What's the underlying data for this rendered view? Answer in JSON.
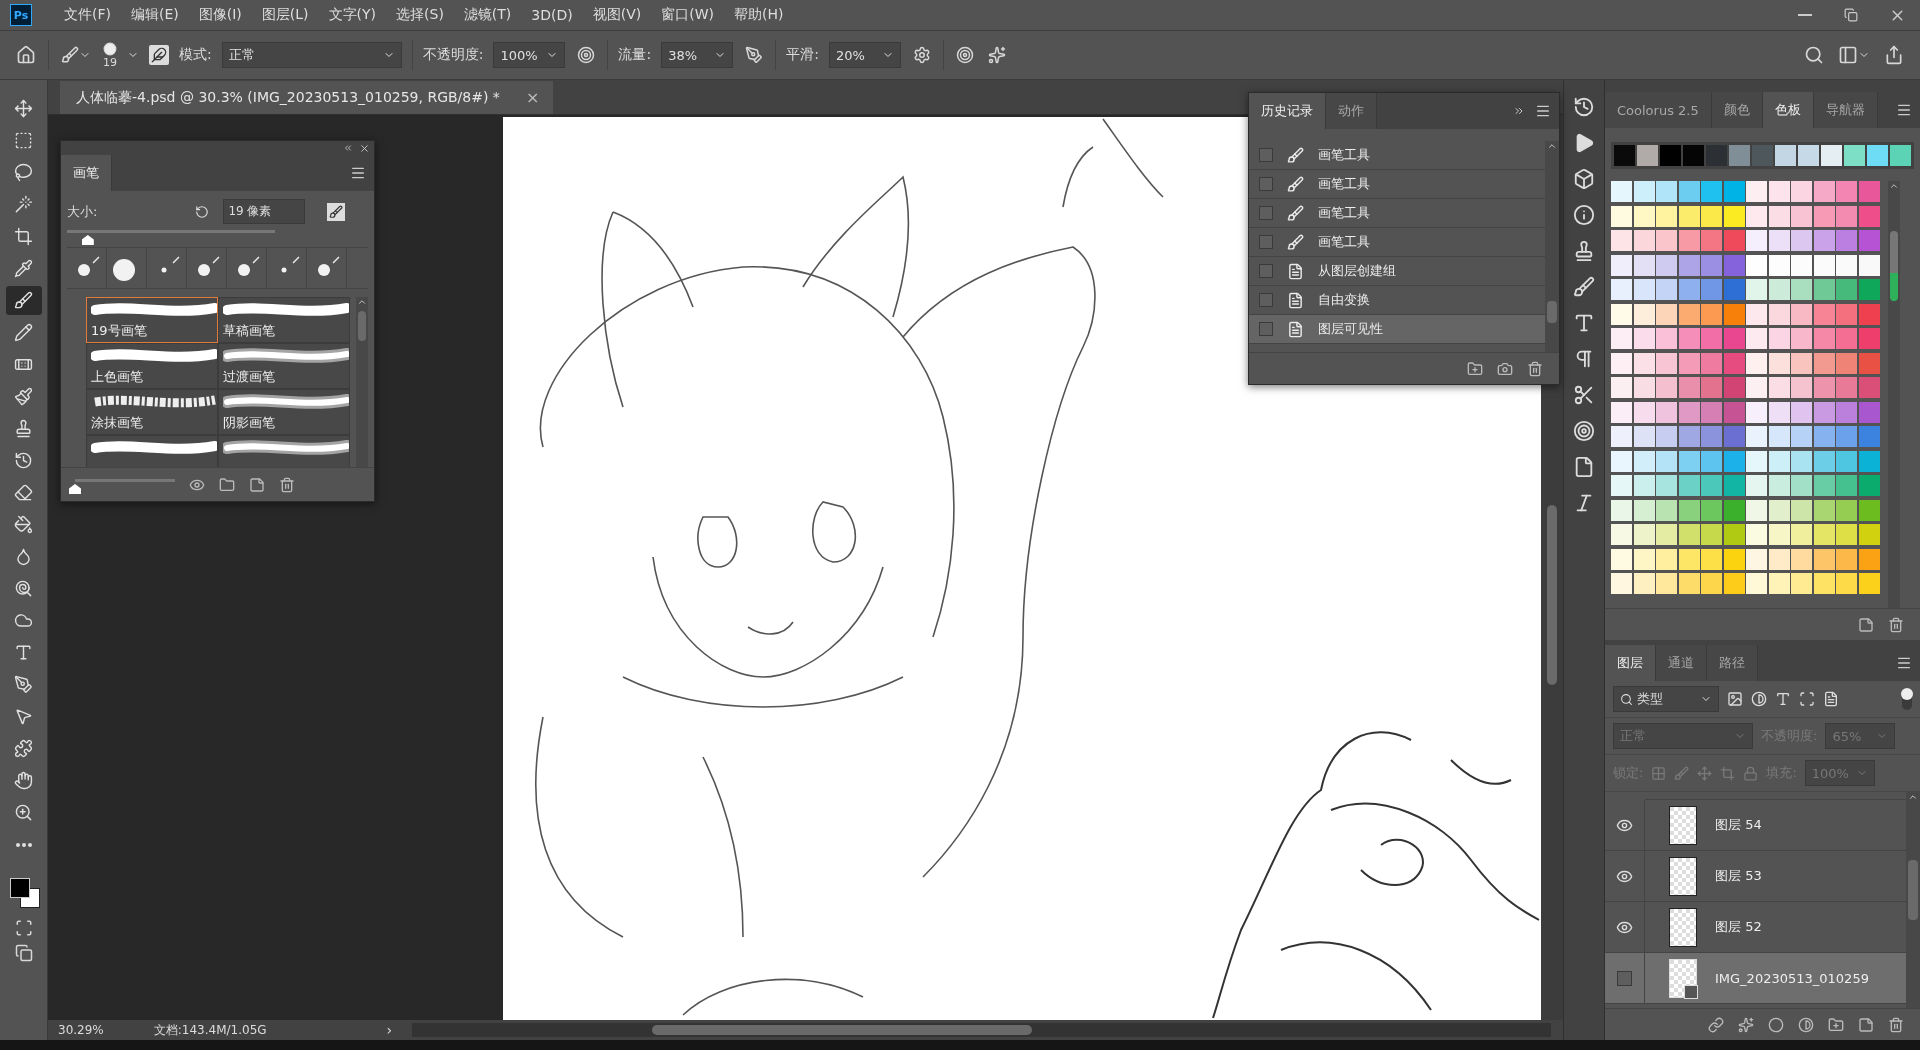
{
  "menu": {
    "logo": "Ps",
    "items": [
      "文件(F)",
      "编辑(E)",
      "图像(I)",
      "图层(L)",
      "文字(Y)",
      "选择(S)",
      "滤镜(T)",
      "3D(D)",
      "视图(V)",
      "窗口(W)",
      "帮助(H)"
    ]
  },
  "options_bar": {
    "brush_size": "19",
    "mode_label": "模式:",
    "mode": "正常",
    "opacity_label": "不透明度:",
    "opacity": "100%",
    "flow_label": "流量:",
    "flow": "38%",
    "smoothing_label": "平滑:",
    "smoothing": "20%"
  },
  "tools": [
    {
      "kind": "move",
      "selected": false
    },
    {
      "kind": "marquee",
      "selected": false
    },
    {
      "kind": "lasso",
      "selected": false
    },
    {
      "kind": "wand",
      "selected": false
    },
    {
      "kind": "crop",
      "selected": false
    },
    {
      "kind": "eyedropper",
      "selected": false
    },
    {
      "kind": "brush",
      "selected": true
    },
    {
      "kind": "pencil",
      "selected": false
    },
    {
      "kind": "healing",
      "selected": false
    },
    {
      "kind": "mixer",
      "selected": false
    },
    {
      "kind": "stamp",
      "selected": false
    },
    {
      "kind": "history",
      "selected": false
    },
    {
      "kind": "eraser",
      "selected": false
    },
    {
      "kind": "bucket",
      "selected": false
    },
    {
      "kind": "blur",
      "selected": false
    },
    {
      "kind": "dodge",
      "selected": false
    },
    {
      "kind": "sponge",
      "selected": false
    },
    {
      "kind": "type",
      "selected": false
    },
    {
      "kind": "pen",
      "selected": false
    },
    {
      "kind": "path",
      "selected": false
    },
    {
      "kind": "shape",
      "selected": false
    },
    {
      "kind": "hand",
      "selected": false
    },
    {
      "kind": "zoom",
      "selected": false
    },
    {
      "kind": "more",
      "selected": false
    }
  ],
  "document_tab": {
    "title": "人体临摹-4.psd @ 30.3% (IMG_20230513_010259, RGB/8#) *",
    "close": "×"
  },
  "brush_panel": {
    "tab": "画笔",
    "size_label": "大小:",
    "size_value": "19 像素",
    "size_slider": {
      "level": 0.1
    },
    "scale_slider": {
      "level": 0
    },
    "presets": [
      {
        "name": "19号画笔",
        "kind": "smooth",
        "selected": true
      },
      {
        "name": "草稿画笔",
        "kind": "smooth",
        "selected": false
      },
      {
        "name": "上色画笔",
        "kind": "smooth",
        "selected": false
      },
      {
        "name": "过渡画笔",
        "kind": "soft",
        "selected": false
      },
      {
        "name": "涂抹画笔",
        "kind": "textured",
        "selected": false
      },
      {
        "name": "阴影画笔",
        "kind": "soft",
        "selected": false
      },
      {
        "kind": "smooth",
        "selected": false
      },
      {
        "kind": "soft",
        "selected": false
      }
    ]
  },
  "history": {
    "tabs": [
      {
        "label": "历史记录",
        "selected": true
      },
      {
        "label": "动作",
        "selected": false
      }
    ],
    "items": [
      {
        "kind": "brush",
        "label": "画笔工具",
        "checked": false,
        "selected": false
      },
      {
        "kind": "brush",
        "label": "画笔工具",
        "checked": false,
        "selected": false
      },
      {
        "kind": "brush",
        "label": "画笔工具",
        "checked": false,
        "selected": false
      },
      {
        "kind": "brush",
        "label": "画笔工具",
        "checked": false,
        "selected": false
      },
      {
        "kind": "document",
        "label": "从图层创建组",
        "checked": false,
        "selected": false
      },
      {
        "kind": "document",
        "label": "自由变换",
        "checked": false,
        "selected": false
      },
      {
        "kind": "document",
        "label": "图层可见性",
        "checked": false,
        "selected": true
      }
    ]
  },
  "swatches": {
    "tabs": [
      {
        "label": "Coolorus 2.5",
        "selected": false
      },
      {
        "label": "颜色",
        "selected": false
      },
      {
        "label": "色板",
        "selected": true
      },
      {
        "label": "导航器",
        "selected": false
      }
    ],
    "recent": [
      {
        "color": "#0a0a0a"
      },
      {
        "color": "#b0aba8"
      },
      {
        "color": "#000000"
      },
      {
        "color": "#050505"
      },
      {
        "color": "#2c3034"
      },
      {
        "color": "#7f8e97"
      },
      {
        "color": "#4d575c"
      },
      {
        "color": "#c2d7e3"
      },
      {
        "color": "#c6d9e6"
      },
      {
        "color": "#e4eef3"
      },
      {
        "color": "#7ddfc6"
      },
      {
        "color": "#6fdcf5"
      },
      {
        "color": "#5dd3b5"
      }
    ],
    "rows": [
      [
        {
          "color": "#e6f6fd"
        },
        {
          "color": "#cdeefb"
        },
        {
          "color": "#b0e4f8"
        },
        {
          "color": "#6dcdf0"
        },
        {
          "color": "#1fc1ee"
        },
        {
          "color": "#00b3e6"
        },
        {
          "color": "#fdeef2"
        },
        {
          "color": "#fde4ec"
        },
        {
          "color": "#fbd5e2"
        },
        {
          "color": "#f6a9c7"
        },
        {
          "color": "#f285b2"
        },
        {
          "color": "#e7579a"
        }
      ],
      [
        {
          "color": "#fffbe0"
        },
        {
          "color": "#fff8c4"
        },
        {
          "color": "#fff3a0"
        },
        {
          "color": "#fcec6c"
        },
        {
          "color": "#fbe94a"
        },
        {
          "color": "#fbeb23"
        },
        {
          "color": "#fde9ee"
        },
        {
          "color": "#fbdde6"
        },
        {
          "color": "#f8c3d2"
        },
        {
          "color": "#f69ab6"
        },
        {
          "color": "#f38ab0"
        },
        {
          "color": "#ee4f8b"
        }
      ],
      [
        {
          "color": "#fde5e7"
        },
        {
          "color": "#fbd6da"
        },
        {
          "color": "#fac6cc"
        },
        {
          "color": "#f79aa5"
        },
        {
          "color": "#f47684"
        },
        {
          "color": "#ef4a5c"
        },
        {
          "color": "#f5eefc"
        },
        {
          "color": "#ecdff8"
        },
        {
          "color": "#dcc7f1"
        },
        {
          "color": "#c9a2e9"
        },
        {
          "color": "#bb7fe1"
        },
        {
          "color": "#b553d4"
        }
      ],
      [
        {
          "color": "#efeefa"
        },
        {
          "color": "#e3e0f6"
        },
        {
          "color": "#cfcaf0"
        },
        {
          "color": "#ada4e8"
        },
        {
          "color": "#9b8fe3"
        },
        {
          "color": "#8463dc"
        },
        {
          "color": "#fefefe"
        },
        {
          "color": "#fdfdfd"
        },
        {
          "color": "#fcfcfc"
        },
        {
          "color": "#fbfbfb"
        },
        {
          "color": "#fafafa"
        },
        {
          "color": "#f9f9f9"
        }
      ],
      [
        {
          "color": "#e8f0fd"
        },
        {
          "color": "#d8e5fb"
        },
        {
          "color": "#c3d4f7"
        },
        {
          "color": "#8fb0ee"
        },
        {
          "color": "#6f97e6"
        },
        {
          "color": "#2e6fd6"
        },
        {
          "color": "#e2f5ea"
        },
        {
          "color": "#ccecd9"
        },
        {
          "color": "#a9dfbf"
        },
        {
          "color": "#6ec997"
        },
        {
          "color": "#45ba7b"
        },
        {
          "color": "#0fa85a"
        }
      ],
      [
        {
          "color": "#fffbe8"
        },
        {
          "color": "#fdeedc"
        },
        {
          "color": "#fcd5b8"
        },
        {
          "color": "#fcab70"
        },
        {
          "color": "#fb9a50"
        },
        {
          "color": "#f7800a"
        },
        {
          "color": "#fde9ed"
        },
        {
          "color": "#fbd7de"
        },
        {
          "color": "#f9b9c4"
        },
        {
          "color": "#f68494"
        },
        {
          "color": "#f4707f"
        },
        {
          "color": "#ef4050"
        }
      ],
      [
        {
          "color": "#fdeef5"
        },
        {
          "color": "#fbdcea"
        },
        {
          "color": "#f9c0d8"
        },
        {
          "color": "#f58fba"
        },
        {
          "color": "#f26ea6"
        },
        {
          "color": "#e94790"
        },
        {
          "color": "#fde9f0"
        },
        {
          "color": "#fbd5e3"
        },
        {
          "color": "#f8b7ca"
        },
        {
          "color": "#f588a6"
        },
        {
          "color": "#f36e92"
        },
        {
          "color": "#ee3e6c"
        }
      ],
      [
        {
          "color": "#fdeff3"
        },
        {
          "color": "#fbe0e8"
        },
        {
          "color": "#f8c5d4"
        },
        {
          "color": "#f49cb7"
        },
        {
          "color": "#f07ba0"
        },
        {
          "color": "#e74c81"
        },
        {
          "color": "#fdf0ee"
        },
        {
          "color": "#fbe0dc"
        },
        {
          "color": "#f8c4bd"
        },
        {
          "color": "#f29a8f"
        },
        {
          "color": "#ef8375"
        },
        {
          "color": "#e95145"
        }
      ],
      [
        {
          "color": "#fceff2"
        },
        {
          "color": "#f9dde4"
        },
        {
          "color": "#f4bfce"
        },
        {
          "color": "#ea8fab"
        },
        {
          "color": "#e3728f"
        },
        {
          "color": "#d24473"
        },
        {
          "color": "#fdf0f3"
        },
        {
          "color": "#fadde5"
        },
        {
          "color": "#f5c2d0"
        },
        {
          "color": "#ed93ac"
        },
        {
          "color": "#e87a98"
        },
        {
          "color": "#d94f77"
        }
      ],
      [
        {
          "color": "#fbeef6"
        },
        {
          "color": "#f6dcec"
        },
        {
          "color": "#efc2dd"
        },
        {
          "color": "#e099c4"
        },
        {
          "color": "#d67fb4"
        },
        {
          "color": "#c65394"
        },
        {
          "color": "#f7effb"
        },
        {
          "color": "#eedef6"
        },
        {
          "color": "#e0c3ef"
        },
        {
          "color": "#c999e2"
        },
        {
          "color": "#bb7fdc"
        },
        {
          "color": "#a957cf"
        }
      ],
      [
        {
          "color": "#eef0fb"
        },
        {
          "color": "#dee2f6"
        },
        {
          "color": "#c6cdf0"
        },
        {
          "color": "#a0a8e3"
        },
        {
          "color": "#8a93dc"
        },
        {
          "color": "#6a6fd1"
        },
        {
          "color": "#eaf2fd"
        },
        {
          "color": "#d6e6fb"
        },
        {
          "color": "#b7d2f7"
        },
        {
          "color": "#86b3ef"
        },
        {
          "color": "#6aa1ea"
        },
        {
          "color": "#3b83df"
        }
      ],
      [
        {
          "color": "#eaf6fd"
        },
        {
          "color": "#d3eefb"
        },
        {
          "color": "#b4e3f8"
        },
        {
          "color": "#7dd0f2"
        },
        {
          "color": "#5cc4ee"
        },
        {
          "color": "#1cb1e8"
        },
        {
          "color": "#e6f7fb"
        },
        {
          "color": "#cdeff7"
        },
        {
          "color": "#a9e3f1"
        },
        {
          "color": "#6dcfe7"
        },
        {
          "color": "#4ec5e1"
        },
        {
          "color": "#0cb1d6"
        }
      ],
      [
        {
          "color": "#e5f7f6"
        },
        {
          "color": "#cbefec"
        },
        {
          "color": "#a7e4df"
        },
        {
          "color": "#6bd1c7"
        },
        {
          "color": "#4cc8bb"
        },
        {
          "color": "#12b4a3"
        },
        {
          "color": "#e4f6ef"
        },
        {
          "color": "#c9eddf"
        },
        {
          "color": "#a3e0c8"
        },
        {
          "color": "#68cda4"
        },
        {
          "color": "#45c190"
        },
        {
          "color": "#0bab6e"
        }
      ],
      [
        {
          "color": "#eaf6e8"
        },
        {
          "color": "#d6eed2"
        },
        {
          "color": "#b9e3b1"
        },
        {
          "color": "#89d17d"
        },
        {
          "color": "#6cc75f"
        },
        {
          "color": "#3bb02c"
        },
        {
          "color": "#f0f7e6"
        },
        {
          "color": "#e2efcd"
        },
        {
          "color": "#cde5a8"
        },
        {
          "color": "#a9d670"
        },
        {
          "color": "#94cd52"
        },
        {
          "color": "#6cbb1f"
        }
      ],
      [
        {
          "color": "#f7f9e4"
        },
        {
          "color": "#eff3c9"
        },
        {
          "color": "#e4eca3"
        },
        {
          "color": "#d1e06a"
        },
        {
          "color": "#c6d94b"
        },
        {
          "color": "#b0ca14"
        },
        {
          "color": "#fbfbe2"
        },
        {
          "color": "#f6f6c6"
        },
        {
          "color": "#efef9e"
        },
        {
          "color": "#e4e465"
        },
        {
          "color": "#dede46"
        },
        {
          "color": "#d1d10f"
        }
      ],
      [
        {
          "color": "#fffbe2"
        },
        {
          "color": "#fff6c6"
        },
        {
          "color": "#ffef9e"
        },
        {
          "color": "#fde566"
        },
        {
          "color": "#fde047"
        },
        {
          "color": "#fbd30f"
        },
        {
          "color": "#fff5e3"
        },
        {
          "color": "#ffebc8"
        },
        {
          "color": "#ffdba0"
        },
        {
          "color": "#fdc468"
        },
        {
          "color": "#fdb84a"
        },
        {
          "color": "#fba114"
        }
      ],
      [
        {
          "color": "#fff7e0"
        },
        {
          "color": "#fff0c2"
        },
        {
          "color": "#ffe79c"
        },
        {
          "color": "#fedc6a"
        },
        {
          "color": "#fed64c"
        },
        {
          "color": "#fdcb1a"
        },
        {
          "color": "#fff9d8"
        },
        {
          "color": "#fff3b8"
        },
        {
          "color": "#ffec92"
        },
        {
          "color": "#fde264"
        },
        {
          "color": "#fddb48"
        },
        {
          "color": "#fcd11c"
        }
      ]
    ]
  },
  "layers": {
    "tabs": [
      {
        "label": "图层",
        "selected": true
      },
      {
        "label": "通道",
        "selected": false
      },
      {
        "label": "路径",
        "selected": false
      }
    ],
    "filter": "类型",
    "blend_mode": "正常",
    "opacity_label": "不透明度:",
    "opacity": "65%",
    "lock_label": "锁定:",
    "fill_label": "填充:",
    "fill": "100%",
    "controls_disabled": true,
    "items": [
      {
        "name": "图层 54",
        "kind": "pixel",
        "visible": true,
        "selected": false
      },
      {
        "name": "图层 53",
        "kind": "pixel",
        "visible": true,
        "selected": false
      },
      {
        "name": "图层 52",
        "kind": "pixel",
        "visible": true,
        "selected": false
      },
      {
        "name": "IMG_20230513_010259",
        "kind": "smart",
        "visible": false,
        "selected": true
      }
    ]
  },
  "status_bar": {
    "zoom": "30.29%",
    "doc_info": "文档:143.4M/1.05G",
    "arrow": "›"
  }
}
